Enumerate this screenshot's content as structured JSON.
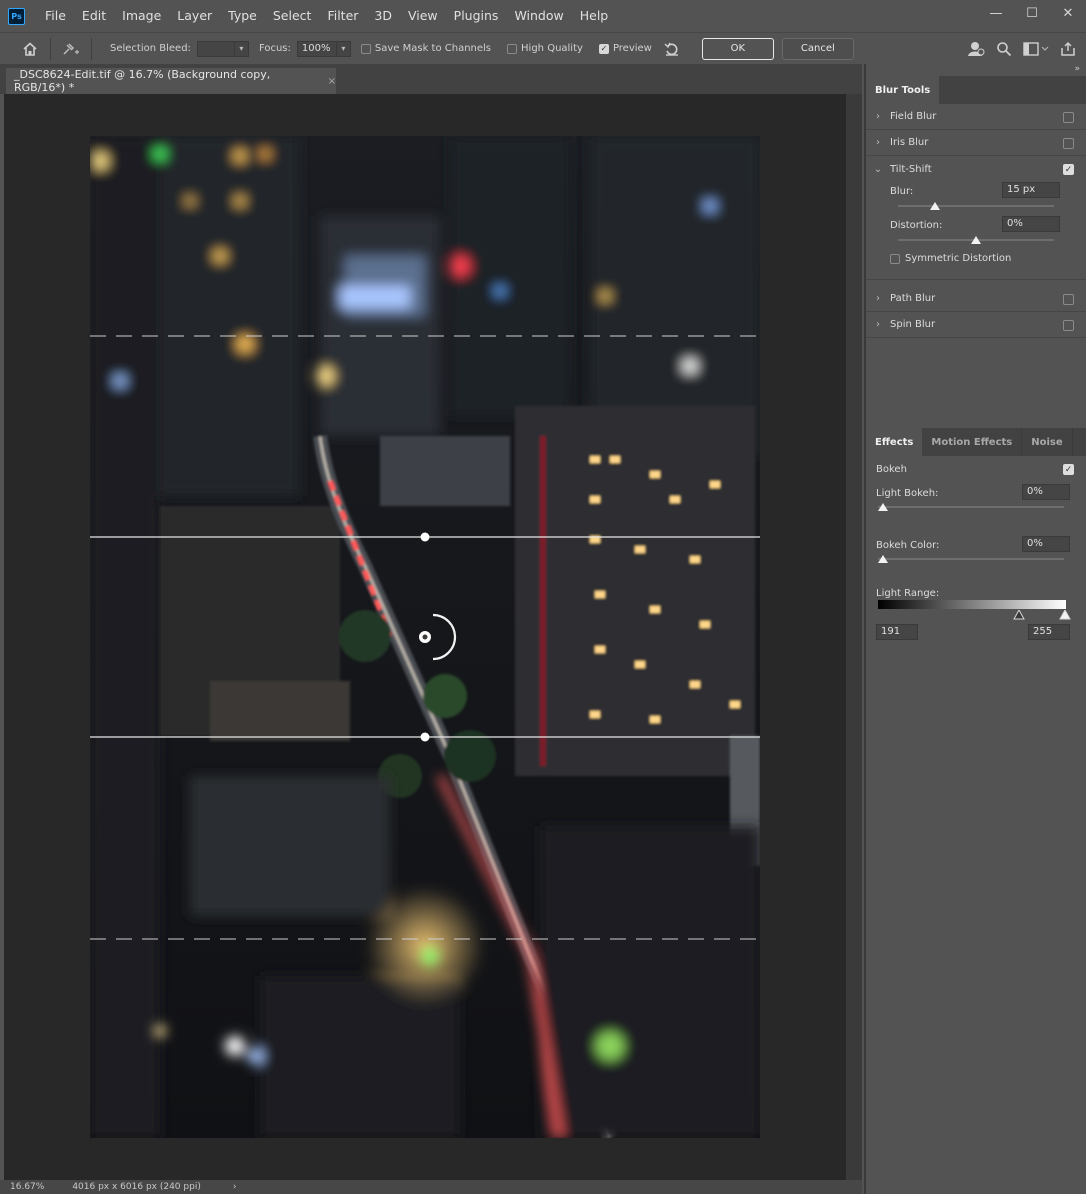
{
  "menu": {
    "logo": "Ps",
    "items": [
      "File",
      "Edit",
      "Image",
      "Layer",
      "Type",
      "Select",
      "Filter",
      "3D",
      "View",
      "Plugins",
      "Window",
      "Help"
    ]
  },
  "window": {
    "minimize": "—",
    "maximize": "☐",
    "close": "✕"
  },
  "options": {
    "selection_bleed_label": "Selection Bleed:",
    "selection_bleed_value": "",
    "focus_label": "Focus:",
    "focus_value": "100%",
    "save_mask_label": "Save Mask to Channels",
    "high_quality_label": "High Quality",
    "preview_label": "Preview",
    "ok_label": "OK",
    "cancel_label": "Cancel"
  },
  "document": {
    "tab_title": "_DSC8624-Edit.tif @ 16.7% (Background copy, RGB/16*) *",
    "close": "×"
  },
  "status": {
    "zoom": "16.67%",
    "info": "4016 px x 6016 px (240 ppi)",
    "arrow": "›"
  },
  "panel": {
    "collapse": "»",
    "blur_tools_tab": "Blur Tools",
    "blur_items": [
      {
        "label": "Field Blur",
        "checked": false
      },
      {
        "label": "Iris Blur",
        "checked": false
      },
      {
        "label": "Tilt-Shift",
        "checked": true
      },
      {
        "label": "Path Blur",
        "checked": false
      },
      {
        "label": "Spin Blur",
        "checked": false
      }
    ],
    "tilt": {
      "blur_label": "Blur:",
      "blur_value": "15 px",
      "blur_level": 0.24,
      "distortion_label": "Distortion:",
      "distortion_value": "0%",
      "distortion_level": 0.5,
      "symmetric_label": "Symmetric Distortion"
    },
    "effects_tabs": [
      "Effects",
      "Motion Effects",
      "Noise"
    ],
    "bokeh_label": "Bokeh",
    "light_bokeh_label": "Light Bokeh:",
    "light_bokeh_value": "0%",
    "bokeh_color_label": "Bokeh Color:",
    "bokeh_color_value": "0%",
    "light_range_label": "Light Range:",
    "light_range_low": "191",
    "light_range_high": "255"
  },
  "check_glyph": "✓"
}
